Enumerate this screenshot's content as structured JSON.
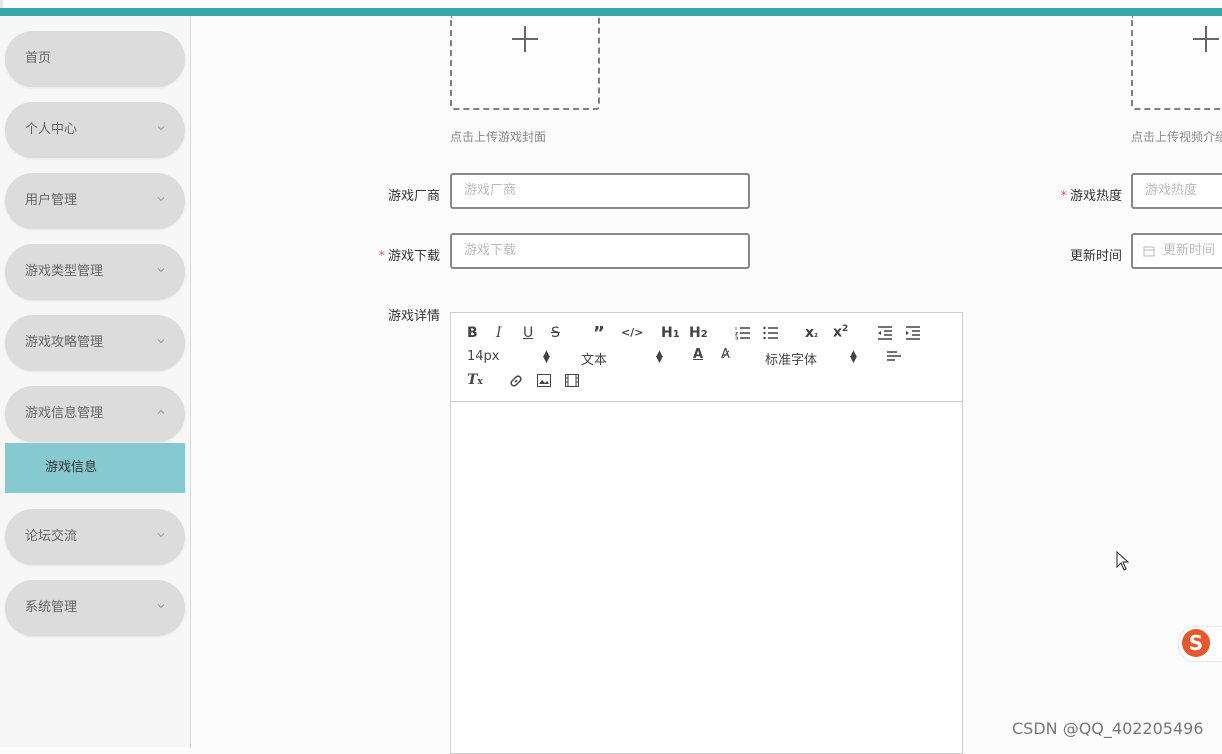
{
  "sidebar": {
    "items": [
      {
        "label": "首页",
        "has_chevron": false
      },
      {
        "label": "个人中心",
        "has_chevron": true
      },
      {
        "label": "用户管理",
        "has_chevron": true
      },
      {
        "label": "游戏类型管理",
        "has_chevron": true
      },
      {
        "label": "游戏攻略管理",
        "has_chevron": true
      },
      {
        "label": "游戏信息管理",
        "has_chevron": true,
        "expanded": true
      },
      {
        "label": "论坛交流",
        "has_chevron": true
      },
      {
        "label": "系统管理",
        "has_chevron": true
      }
    ],
    "active_submenu": {
      "label": "游戏信息"
    }
  },
  "form": {
    "cover_upload_hint": "点击上传游戏封面",
    "video_upload_hint": "点击上传视频介绍",
    "vendor": {
      "label": "游戏厂商",
      "placeholder": "游戏厂商",
      "required": false
    },
    "heat": {
      "label": "游戏热度",
      "placeholder": "游戏热度",
      "required": true
    },
    "download": {
      "label": "游戏下载",
      "placeholder": "游戏下载",
      "required": true
    },
    "update_time": {
      "label": "更新时间",
      "placeholder": "更新时间",
      "required": false
    },
    "details": {
      "label": "游戏详情"
    }
  },
  "editor": {
    "font_size": "14px",
    "text_style": "文本",
    "font_family": "标准字体"
  },
  "watermark": "CSDN @QQ_402205496",
  "colors": {
    "topbar": "#3aa5a8",
    "active_submenu": "#87c9d1",
    "menu_pill": "#dcdcdc"
  }
}
